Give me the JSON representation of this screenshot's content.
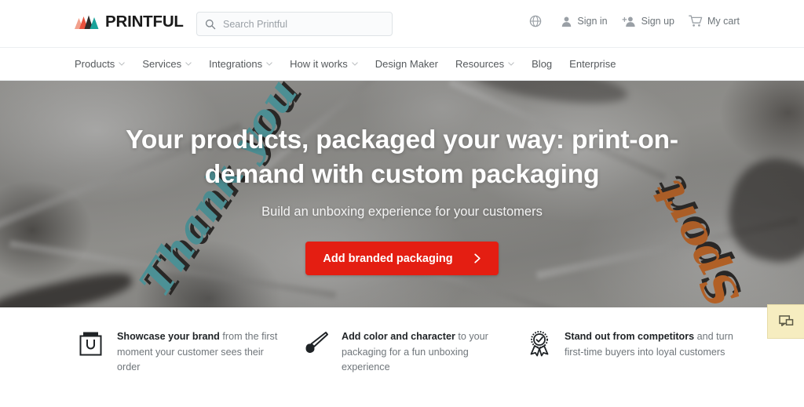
{
  "site": {
    "brand_name": "PRINTFUL",
    "accent_red": "#e41e12",
    "logo_colors": [
      "#f2a08c",
      "#e8523d",
      "#c0392b",
      "#2f2b28",
      "#1aa39a"
    ]
  },
  "header": {
    "search": {
      "placeholder": "Search Printful",
      "value": "",
      "icon": "search-icon"
    },
    "utility": [
      {
        "label": "",
        "icon": "globe-icon",
        "name": "language-selector"
      },
      {
        "label": "Sign in",
        "icon": "user-icon",
        "name": "sign-in"
      },
      {
        "label": "Sign up",
        "icon": "user-plus-icon",
        "name": "sign-up"
      },
      {
        "label": "My cart",
        "icon": "cart-icon",
        "name": "my-cart"
      }
    ]
  },
  "nav": {
    "items": [
      {
        "label": "Products",
        "has_dropdown": true
      },
      {
        "label": "Services",
        "has_dropdown": true
      },
      {
        "label": "Integrations",
        "has_dropdown": true
      },
      {
        "label": "How it works",
        "has_dropdown": true
      },
      {
        "label": "Design Maker",
        "has_dropdown": false
      },
      {
        "label": "Resources",
        "has_dropdown": true
      },
      {
        "label": "Blog",
        "has_dropdown": false
      },
      {
        "label": "Enterprise",
        "has_dropdown": false
      }
    ]
  },
  "hero": {
    "title": "Your products, packaged your way: print-on-demand with custom packaging",
    "subtitle": "Build an unboxing experience for your customers",
    "cta_label": "Add branded packaging",
    "cta_icon": "chevron-right-icon",
    "background_art": {
      "left_script": "Thank you",
      "left_script_color": "#55b6bd",
      "right_script": "Sport",
      "right_script_color": "#e4711f"
    }
  },
  "features": [
    {
      "icon": "shopping-bag-icon",
      "bold": "Showcase your brand",
      "rest": " from the first moment your customer sees their order"
    },
    {
      "icon": "paintbrush-icon",
      "bold": "Add color and character",
      "rest": " to your packaging for a fun unboxing experience"
    },
    {
      "icon": "award-ribbon-icon",
      "bold": "Stand out from competitors",
      "rest": " and turn first-time buyers into loyal customers"
    }
  ],
  "chat": {
    "icon": "chat-bubble-icon",
    "label": ""
  }
}
